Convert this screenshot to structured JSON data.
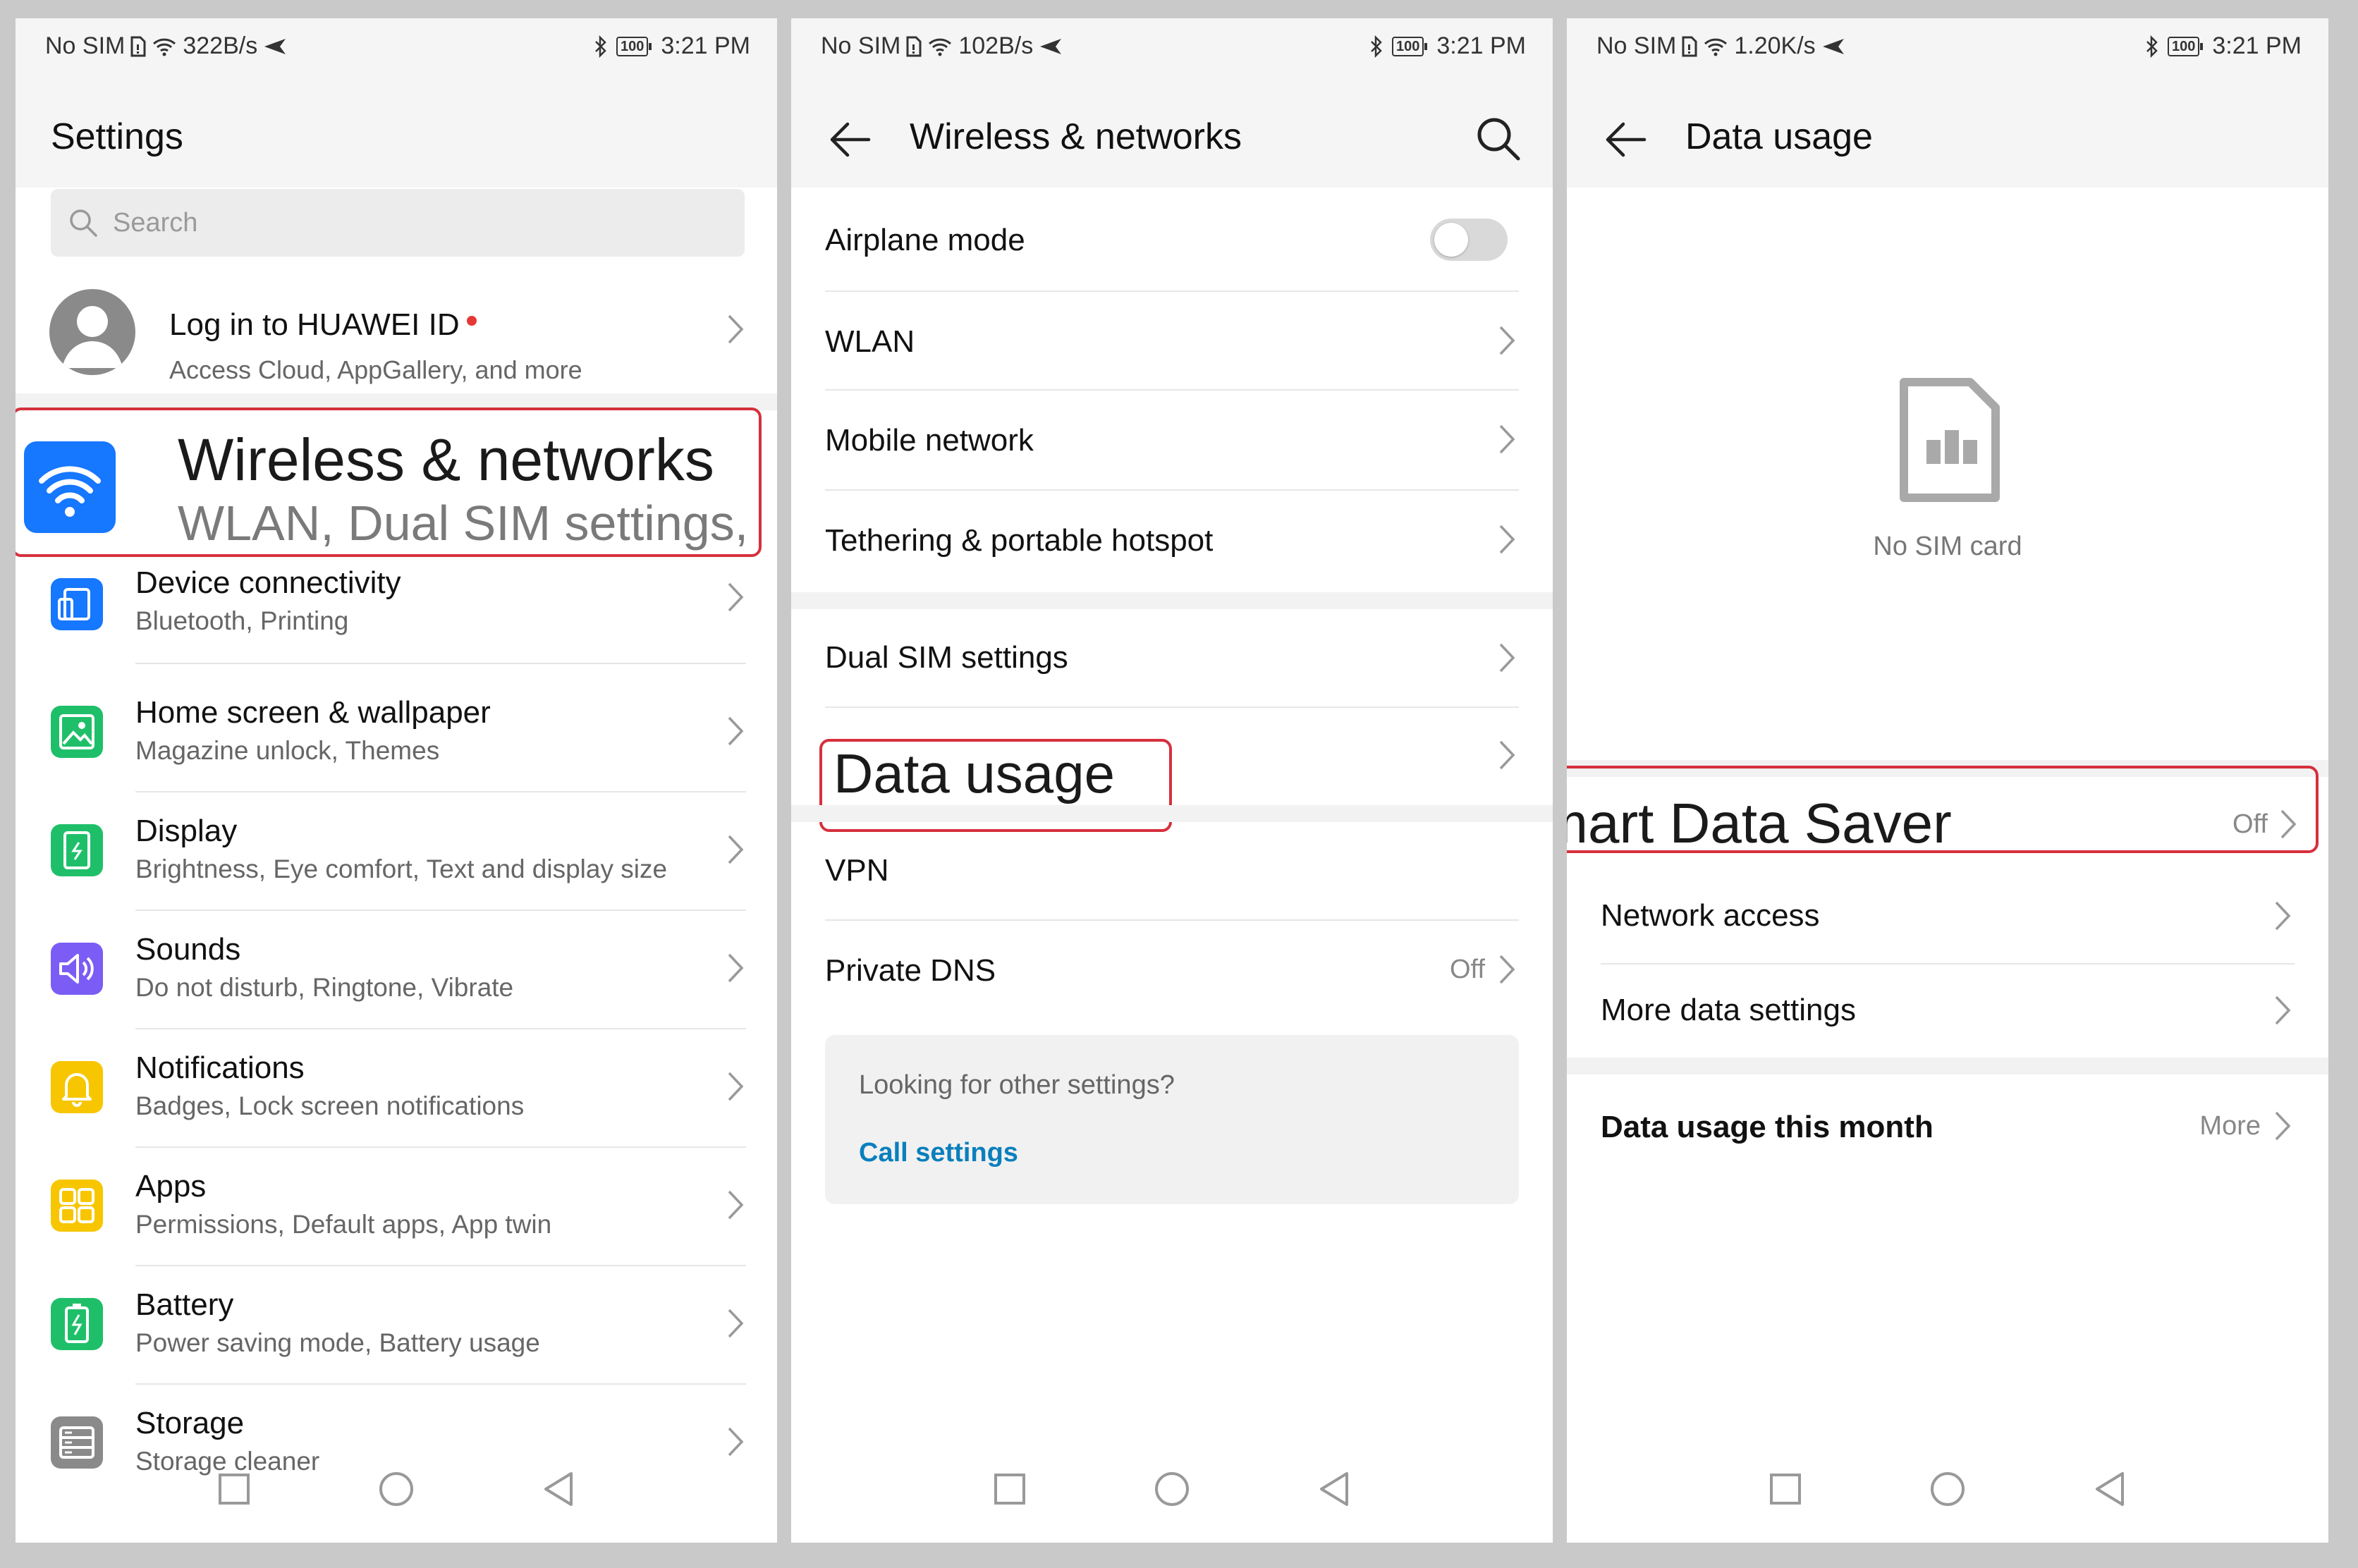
{
  "status_bars": [
    {
      "carrier": "No SIM",
      "speed": "322B/s",
      "battery": "100",
      "time": "3:21 PM"
    },
    {
      "carrier": "No SIM",
      "speed": "102B/s",
      "battery": "100",
      "time": "3:21 PM"
    },
    {
      "carrier": "No SIM",
      "speed": "1.20K/s",
      "battery": "100",
      "time": "3:21 PM"
    }
  ],
  "settings_panel": {
    "title": "Settings",
    "search_placeholder": "Search",
    "account": {
      "title": "Log in to HUAWEI ID",
      "subtitle": "Access Cloud, AppGallery, and more"
    },
    "highlight": {
      "title": "Wireless & networks",
      "subtitle": "WLAN, Dual SIM settings,"
    },
    "items": [
      {
        "title": "Device connectivity",
        "subtitle": "Bluetooth, Printing",
        "icon": "device-connectivity-icon",
        "color": "#1677ff"
      },
      {
        "title": "Home screen & wallpaper",
        "subtitle": "Magazine unlock, Themes",
        "icon": "wallpaper-icon",
        "color": "#1fbf6a"
      },
      {
        "title": "Display",
        "subtitle": "Brightness, Eye comfort, Text and display size",
        "icon": "display-icon",
        "color": "#1fbf6a"
      },
      {
        "title": "Sounds",
        "subtitle": "Do not disturb, Ringtone, Vibrate",
        "icon": "sound-icon",
        "color": "#7b5cf5"
      },
      {
        "title": "Notifications",
        "subtitle": "Badges, Lock screen notifications",
        "icon": "bell-icon",
        "color": "#f7c600"
      },
      {
        "title": "Apps",
        "subtitle": "Permissions, Default apps, App twin",
        "icon": "apps-icon",
        "color": "#f7c600"
      },
      {
        "title": "Battery",
        "subtitle": "Power saving mode, Battery usage",
        "icon": "battery-icon",
        "color": "#1fbf6a"
      },
      {
        "title": "Storage",
        "subtitle": "Storage cleaner",
        "icon": "storage-icon",
        "color": "#8a8a8a"
      }
    ]
  },
  "wireless_panel": {
    "title": "Wireless & networks",
    "group1": [
      "Airplane mode",
      "WLAN",
      "Mobile network",
      "Tethering & portable hotspot"
    ],
    "dual_sim": "Dual SIM settings",
    "data_usage": "Data usage",
    "vpn": "VPN",
    "private_dns": {
      "label": "Private DNS",
      "value": "Off"
    },
    "info": {
      "question": "Looking for other settings?",
      "link": "Call settings"
    }
  },
  "data_usage_panel": {
    "title": "Data usage",
    "no_sim": "No SIM card",
    "smart_saver": {
      "label": "Smart Data Saver",
      "value": "Off"
    },
    "network_access": "Network access",
    "more_data_settings": "More data settings",
    "this_month": {
      "label": "Data usage this month",
      "value": "More"
    }
  },
  "colors": {
    "highlight": "#d6303d",
    "link": "#0a7fbd",
    "wireless_icon": "#1677ff"
  }
}
